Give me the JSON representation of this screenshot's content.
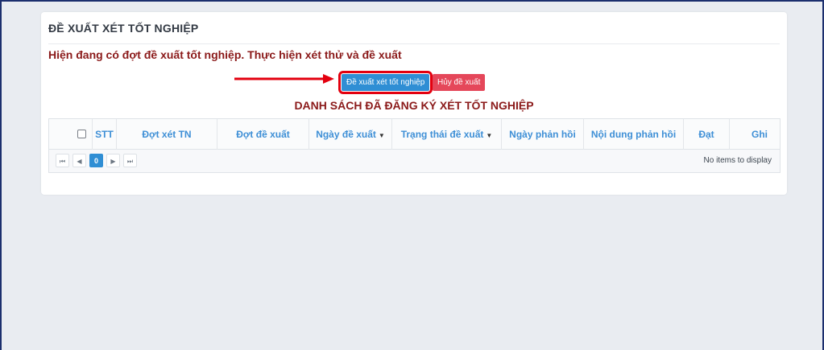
{
  "page": {
    "title": "ĐỀ XUẤT XÉT TỐT NGHIỆP"
  },
  "notice": {
    "text": "Hiện đang có đợt đề xuất tốt nghiệp. Thực hiện xét thử và đề xuất"
  },
  "actions": {
    "propose_label": "Đề xuất xét tốt nghiệp",
    "cancel_label": "Hủy đề xuất"
  },
  "list": {
    "title": "DANH SÁCH ĐÃ ĐĂNG KÝ XÉT TỐT NGHIỆP"
  },
  "grid": {
    "columns": [
      {
        "label": "STT"
      },
      {
        "label": "Đợt xét TN"
      },
      {
        "label": "Đợt đề xuất"
      },
      {
        "label": "Ngày đề xuất",
        "sortable": true
      },
      {
        "label": "Trạng thái đề xuất",
        "sortable": true
      },
      {
        "label": "Ngày phản hồi"
      },
      {
        "label": "Nội dung phản hồi"
      },
      {
        "label": "Đạt"
      },
      {
        "label": "Ghi"
      }
    ],
    "sort_indicator": "▼",
    "pager": {
      "first_icon": "⏮",
      "prev_icon": "◀",
      "next_icon": "▶",
      "last_icon": "⏭",
      "current_page": "0",
      "empty_text": "No items to display"
    }
  },
  "colors": {
    "accent": "#2f8ed4",
    "danger": "#e5475a",
    "highlight": "#e3000f",
    "heading_dark_red": "#8b1a1a",
    "column_header": "#3e8fd6"
  }
}
